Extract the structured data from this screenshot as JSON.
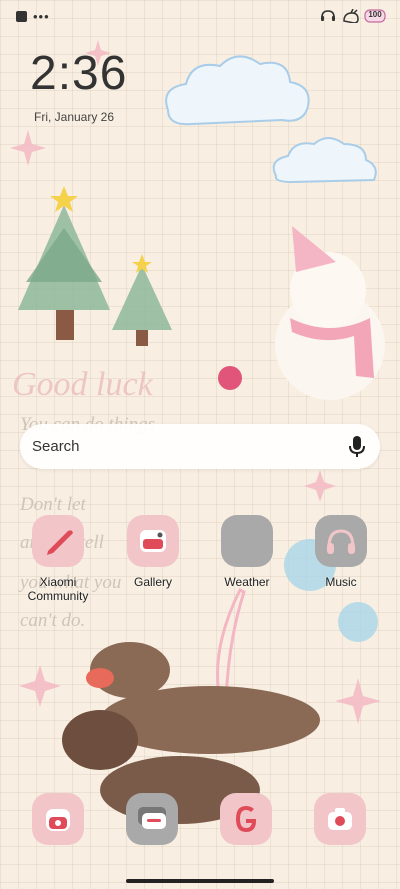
{
  "status_bar": {
    "left_icons": [
      "notification-square-icon",
      "more-dots-icon"
    ],
    "right_icons": [
      "bluetooth-headset-icon",
      "rabbit-wifi-icon",
      "battery-icon"
    ],
    "battery": "100"
  },
  "lockscreen": {
    "time": "2:36",
    "date": "Fri, January 26"
  },
  "search": {
    "placeholder": "Search",
    "icon": "mic-icon"
  },
  "apps": [
    {
      "label": "Xiaomi Community",
      "icon": "pencil-icon",
      "color": "#f2c6c9"
    },
    {
      "label": "Gallery",
      "icon": "gallery-icon",
      "color": "#f2c6c9"
    },
    {
      "label": "Weather",
      "icon": "weather-icon",
      "color": "#a9a9a9"
    },
    {
      "label": "Music",
      "icon": "headphones-icon",
      "color": "#a9a9a9"
    }
  ],
  "dock": [
    {
      "name": "phone",
      "icon": "phone-icon"
    },
    {
      "name": "messages",
      "icon": "messages-icon"
    },
    {
      "name": "google",
      "icon": "google-icon"
    },
    {
      "name": "camera",
      "icon": "camera-icon"
    }
  ],
  "wallpaper": {
    "handwriting": [
      "Good luck",
      "You can do things",
      "Don't let",
      "anyone tell",
      "you what you",
      "can't do."
    ]
  },
  "colors": {
    "background": "#f8efe2",
    "pink": "#f2c6c9",
    "grey_icon": "#a9a9a9",
    "text": "#222222"
  }
}
